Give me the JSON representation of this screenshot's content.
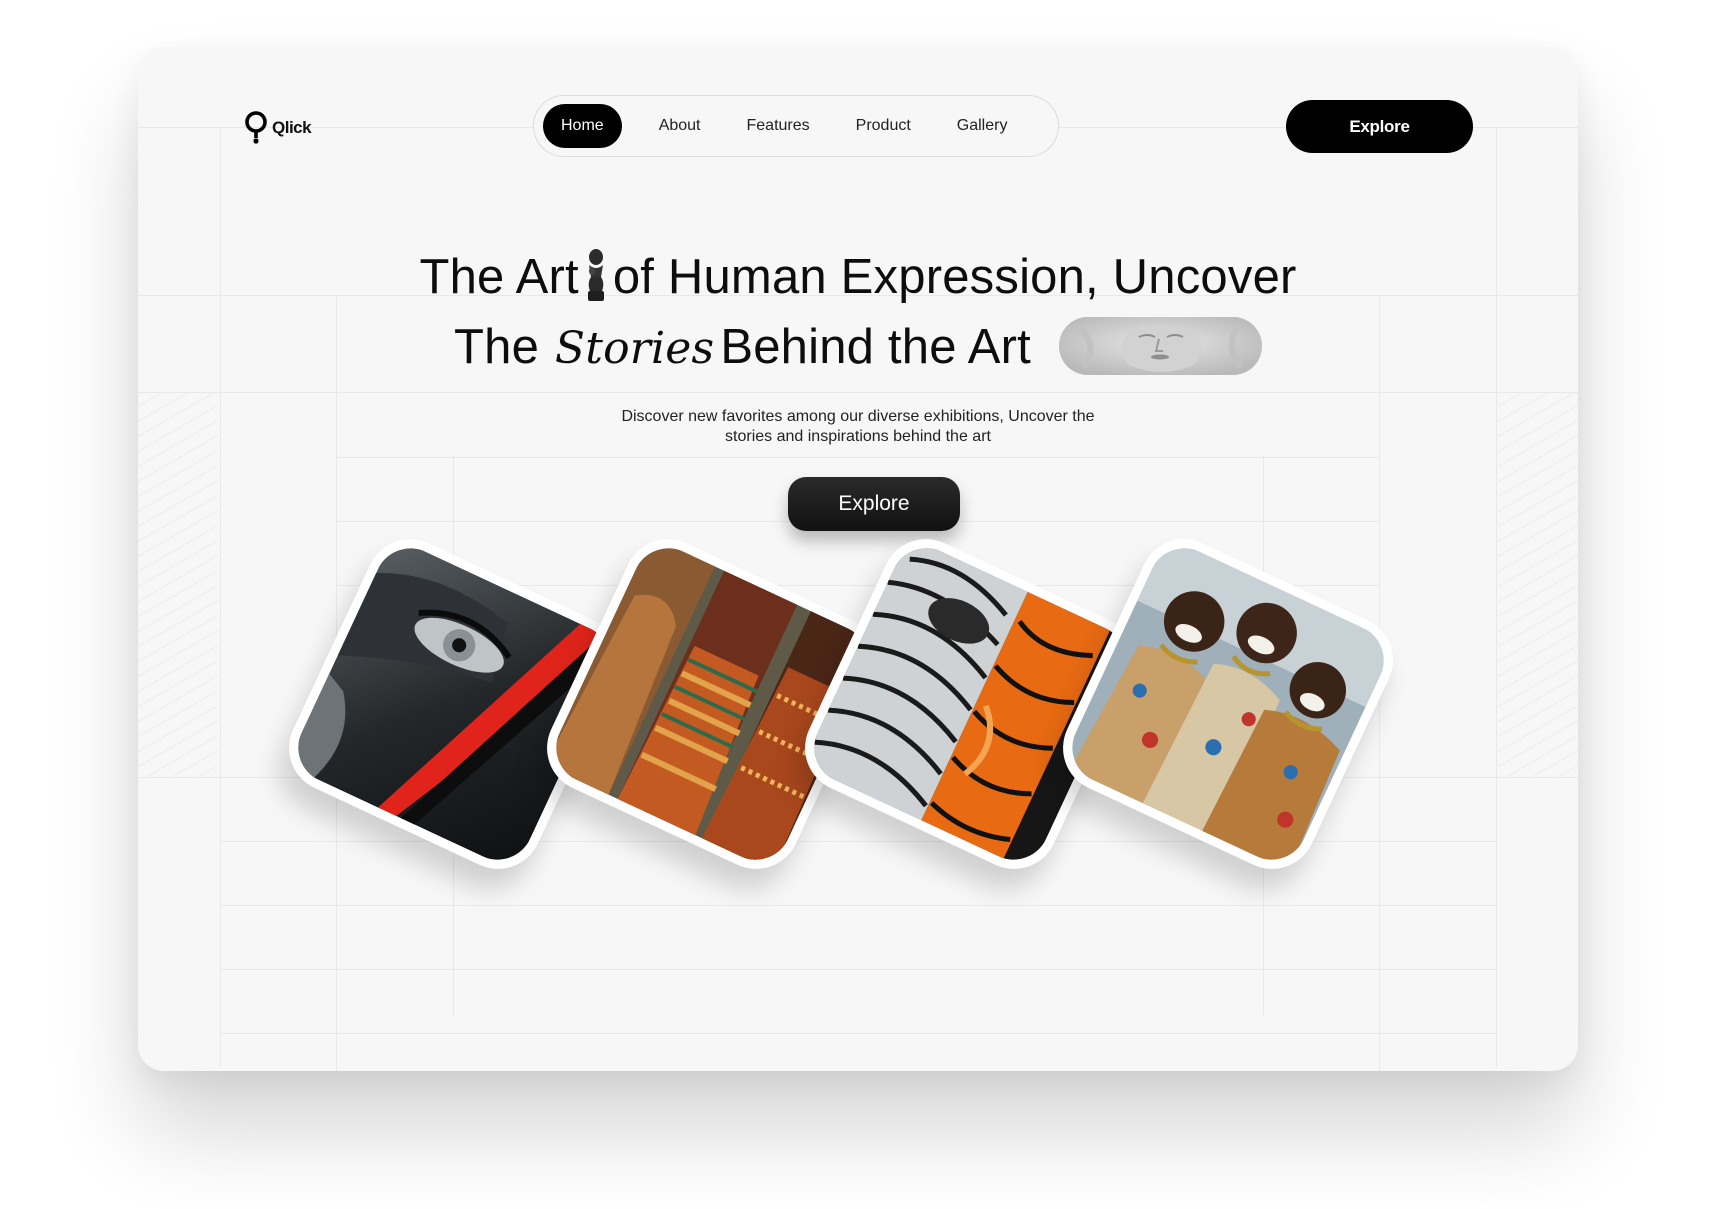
{
  "brand": {
    "name": "Qlick",
    "icon": "pin-logo-icon"
  },
  "nav": {
    "items": [
      {
        "label": "Home",
        "active": true
      },
      {
        "label": "About",
        "active": false
      },
      {
        "label": "Features",
        "active": false
      },
      {
        "label": "Product",
        "active": false
      },
      {
        "label": "Gallery",
        "active": false
      }
    ]
  },
  "header": {
    "cta_label": "Explore"
  },
  "hero": {
    "line1_start": "The Art",
    "line1_end": "of Human Expression, Uncover",
    "line2_start": "The",
    "line2_script": "Stories",
    "line2_end": "Behind the Art",
    "subtitle_line1": "Discover new favorites among our diverse exhibitions, Uncover the",
    "subtitle_line2": "stories and inspirations behind the art",
    "cta_label": "Explore"
  },
  "gallery": {
    "cards": [
      {
        "name": "monochrome-eye-portrait",
        "accent": "#e0241b"
      },
      {
        "name": "women-patterned-dresses",
        "accent": "#b5622a"
      },
      {
        "name": "zebra-orange-face-art",
        "accent": "#e86a12"
      },
      {
        "name": "laughing-children",
        "accent": "#c98a3a"
      }
    ]
  },
  "colors": {
    "background": "#f7f7f7",
    "primary": "#000000",
    "text": "#0d0d0d"
  }
}
